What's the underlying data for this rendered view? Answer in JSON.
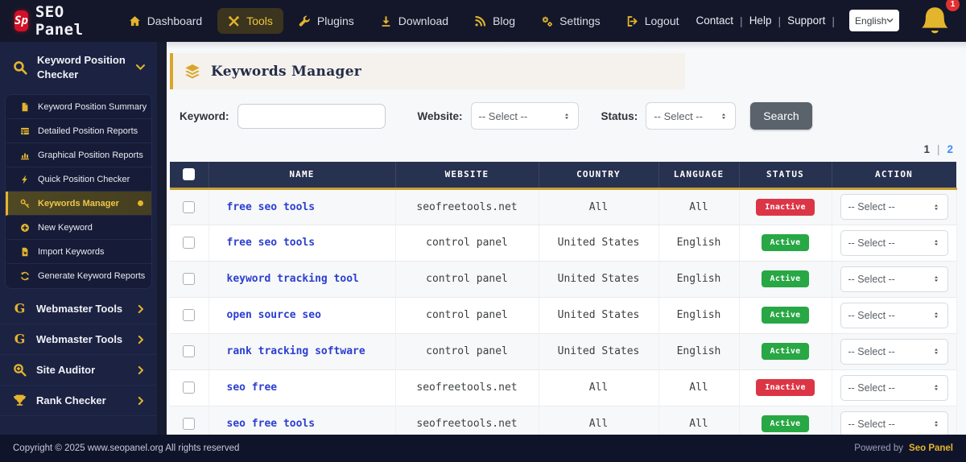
{
  "navbar": {
    "brand": "SEO Panel",
    "logo_text": "Sp",
    "items": [
      {
        "label": "Dashboard",
        "icon": "home",
        "active": false
      },
      {
        "label": "Tools",
        "icon": "tools",
        "active": true
      },
      {
        "label": "Plugins",
        "icon": "wrench",
        "active": false
      },
      {
        "label": "Download",
        "icon": "download",
        "active": false
      },
      {
        "label": "Blog",
        "icon": "blog",
        "active": false
      },
      {
        "label": "Settings",
        "icon": "gears",
        "active": false
      },
      {
        "label": "Logout",
        "icon": "logout",
        "active": false
      }
    ],
    "links": [
      {
        "label": "Contact"
      },
      {
        "label": "Help"
      },
      {
        "label": "Support"
      }
    ],
    "language": "English",
    "notification_count": "1"
  },
  "sidebar": {
    "section_label": "Keyword Position Checker",
    "items": [
      {
        "label": "Keyword Position Summary",
        "icon": "doc",
        "active": false
      },
      {
        "label": "Detailed Position Reports",
        "icon": "tablelist",
        "active": false
      },
      {
        "label": "Graphical Position Reports",
        "icon": "chart",
        "active": false
      },
      {
        "label": "Quick Position Checker",
        "icon": "bolt",
        "active": false
      },
      {
        "label": "Keywords Manager",
        "icon": "key",
        "active": true
      },
      {
        "label": "New Keyword",
        "icon": "pluscircle",
        "active": false
      },
      {
        "label": "Import Keywords",
        "icon": "import",
        "active": false
      },
      {
        "label": "Generate Keyword Reports",
        "icon": "sync",
        "active": false
      }
    ],
    "sections": [
      {
        "label": "Webmaster Tools",
        "icon": "google"
      },
      {
        "label": "Webmaster Tools",
        "icon": "google"
      },
      {
        "label": "Site Auditor",
        "icon": "searchplus"
      },
      {
        "label": "Rank Checker",
        "icon": "trophy"
      }
    ]
  },
  "main": {
    "title": "Keywords Manager",
    "filters": {
      "keyword_label": "Keyword:",
      "keyword_value": "",
      "website_label": "Website:",
      "website_value": "-- Select --",
      "status_label": "Status:",
      "status_value": "-- Select --",
      "search_label": "Search"
    },
    "pagination": {
      "current": "1",
      "separator": "|",
      "next": "2"
    },
    "table": {
      "headers": [
        "NAME",
        "WEBSITE",
        "COUNTRY",
        "LANGUAGE",
        "STATUS",
        "ACTION"
      ],
      "action_value": "-- Select --",
      "rows": [
        {
          "name": "free seo tools",
          "website": "seofreetools.net",
          "country": "All",
          "language": "All",
          "status": "Inactive"
        },
        {
          "name": "free seo tools",
          "website": "control panel",
          "country": "United States",
          "language": "English",
          "status": "Active"
        },
        {
          "name": "keyword tracking tool",
          "website": "control panel",
          "country": "United States",
          "language": "English",
          "status": "Active"
        },
        {
          "name": "open source seo",
          "website": "control panel",
          "country": "United States",
          "language": "English",
          "status": "Active"
        },
        {
          "name": "rank tracking software",
          "website": "control panel",
          "country": "United States",
          "language": "English",
          "status": "Active"
        },
        {
          "name": "seo free",
          "website": "seofreetools.net",
          "country": "All",
          "language": "All",
          "status": "Inactive"
        },
        {
          "name": "seo free tools",
          "website": "seofreetools.net",
          "country": "All",
          "language": "All",
          "status": "Active"
        }
      ]
    }
  },
  "footer": {
    "copyright": "Copyright © 2025 www.seopanel.org All rights reserved",
    "powered_by": "Powered by",
    "brand": "Seo Panel"
  },
  "colors": {
    "accent_yellow": "#e5b52e",
    "active_green": "#28a745",
    "inactive_red": "#dc3545",
    "link_blue": "#2b3fd1",
    "navbar_bg": "#14172a",
    "sidebar_bg": "#1c2242",
    "table_header_bg": "#273150",
    "logo_red": "#d31027"
  }
}
